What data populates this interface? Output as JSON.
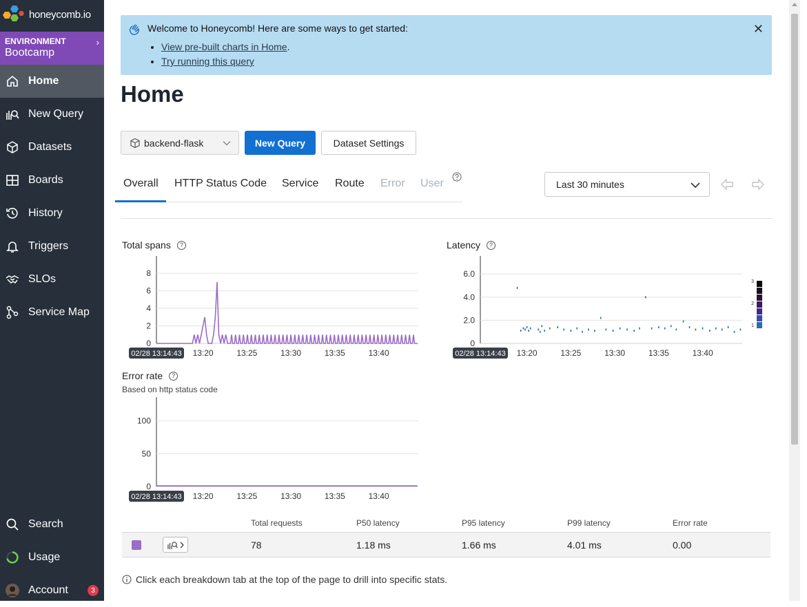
{
  "brand": {
    "name": "honeycomb.io"
  },
  "environment": {
    "label": "ENVIRONMENT",
    "name": "Bootcamp"
  },
  "nav": {
    "home": "Home",
    "new_query": "New Query",
    "datasets": "Datasets",
    "boards": "Boards",
    "history": "History",
    "triggers": "Triggers",
    "slos": "SLOs",
    "service_map": "Service Map",
    "search": "Search",
    "usage": "Usage",
    "account": "Account",
    "account_badge": "3"
  },
  "banner": {
    "title": "Welcome to Honeycomb! Here are some ways to get started:",
    "links": [
      "View pre-built charts in Home",
      "Try running this query"
    ]
  },
  "page": {
    "title": "Home"
  },
  "toolbar": {
    "dataset": "backend-flask",
    "new_query": "New Query",
    "dataset_settings": "Dataset Settings"
  },
  "tabs": {
    "overall": "Overall",
    "http_status_code": "HTTP Status Code",
    "service": "Service",
    "route": "Route",
    "error": "Error",
    "user": "User"
  },
  "time_range": {
    "value": "Last 30 minutes"
  },
  "charts": {
    "total_spans": {
      "title": "Total spans",
      "start_label": "02/28 13:14:43"
    },
    "latency": {
      "title": "Latency",
      "start_label": "02/28 13:14:43"
    },
    "error_rate": {
      "title": "Error rate",
      "subtitle": "Based on http status code",
      "start_label": "02/28 13:14:43"
    }
  },
  "chart_data": [
    {
      "type": "line",
      "title": "Total spans",
      "x_ticks": [
        "13:20",
        "13:25",
        "13:30",
        "13:35",
        "13:40"
      ],
      "y_ticks": [
        0,
        2,
        4,
        6,
        8
      ],
      "ylim": [
        0,
        9.5
      ],
      "series": [
        {
          "color": "#9b6dc6",
          "x": [
            14.7,
            18.8,
            19.0,
            19.2,
            19.4,
            19.6,
            19.8,
            20.0,
            20.2,
            20.4,
            20.6,
            21.0,
            21.2,
            21.4,
            21.6,
            21.8,
            22.0,
            22.2,
            22.4,
            22.6,
            22.8,
            44.4
          ],
          "y": [
            0,
            0,
            1,
            0,
            1,
            0,
            1,
            2,
            3,
            1,
            0,
            0,
            1,
            3,
            7,
            1,
            0,
            1,
            0,
            1,
            0,
            0
          ],
          "periodic_pulses": {
            "from": 22.8,
            "to": 44.4,
            "interval": 0.45,
            "value": 1
          }
        }
      ]
    },
    {
      "type": "heatmap",
      "title": "Latency",
      "x_ticks": [
        "13:20",
        "13:25",
        "13:30",
        "13:35",
        "13:40"
      ],
      "y_ticks": [
        "0",
        "2.0",
        "4.0",
        "6.0"
      ],
      "ylim": [
        0,
        7.2
      ],
      "points": [
        [
          18.9,
          4.8
        ],
        [
          19.3,
          1.1
        ],
        [
          19.6,
          1.3
        ],
        [
          19.8,
          1.2
        ],
        [
          20.0,
          1.4
        ],
        [
          20.2,
          1.1
        ],
        [
          20.4,
          1.3
        ],
        [
          21.3,
          1.2
        ],
        [
          21.5,
          1.0
        ],
        [
          21.7,
          1.5
        ],
        [
          22.0,
          1.1
        ],
        [
          22.6,
          1.3
        ],
        [
          23.5,
          1.4
        ],
        [
          24.2,
          1.2
        ],
        [
          25.0,
          1.1
        ],
        [
          25.7,
          1.3
        ],
        [
          26.3,
          1.0
        ],
        [
          27.0,
          1.2
        ],
        [
          27.7,
          1.1
        ],
        [
          28.4,
          2.2
        ],
        [
          29.0,
          1.2
        ],
        [
          29.8,
          1.1
        ],
        [
          30.6,
          1.3
        ],
        [
          31.4,
          1.2
        ],
        [
          32.2,
          1.1
        ],
        [
          32.8,
          1.3
        ],
        [
          33.5,
          4.0
        ],
        [
          34.2,
          1.3
        ],
        [
          35.0,
          1.4
        ],
        [
          35.7,
          1.3
        ],
        [
          36.4,
          1.5
        ],
        [
          37.0,
          1.2
        ],
        [
          37.8,
          1.9
        ],
        [
          38.5,
          1.4
        ],
        [
          39.2,
          1.2
        ],
        [
          40.0,
          1.3
        ],
        [
          40.8,
          1.1
        ],
        [
          41.5,
          1.3
        ],
        [
          42.2,
          1.2
        ],
        [
          42.9,
          1.4
        ],
        [
          43.6,
          1.0
        ],
        [
          44.3,
          1.2
        ]
      ],
      "legend": [
        "3",
        "2",
        "1"
      ]
    },
    {
      "type": "line",
      "title": "Error rate",
      "x_ticks": [
        "13:20",
        "13:25",
        "13:30",
        "13:35",
        "13:40"
      ],
      "y_ticks": [
        0,
        50,
        100
      ],
      "ylim": [
        0,
        130
      ],
      "series": [
        {
          "color": "#9b6dc6",
          "x": [
            14.7,
            44.4
          ],
          "y": [
            0,
            0
          ]
        }
      ]
    }
  ],
  "stats": {
    "headers": [
      "Total requests",
      "P50 latency",
      "P95 latency",
      "P99 latency",
      "Error rate"
    ],
    "row": [
      "78",
      "1.18 ms",
      "1.66 ms",
      "4.01 ms",
      "0.00"
    ]
  },
  "footer_note": "Click each breakdown tab at the top of the page to drill into specific stats.",
  "colors": {
    "sidebar": "#262f3a",
    "environment": "#7f49b6",
    "primary": "#1170d1",
    "series": "#9b6dc6",
    "heatmap": "#2a6fa8"
  }
}
